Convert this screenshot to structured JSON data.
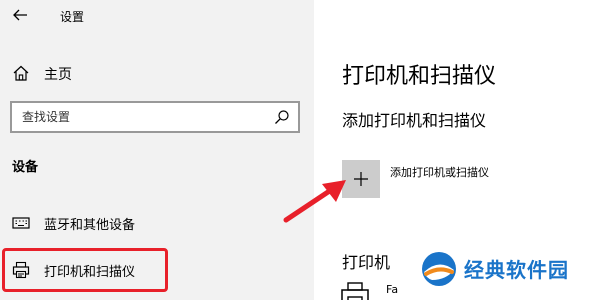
{
  "window": {
    "title": "设置"
  },
  "sidebar": {
    "home_label": "主页",
    "search": {
      "placeholder": "查找设置"
    },
    "section_title": "设备",
    "items": [
      {
        "label": "蓝牙和其他设备",
        "icon": "keyboard-icon"
      },
      {
        "label": "打印机和扫描仪",
        "icon": "printer-icon",
        "highlighted": true
      }
    ]
  },
  "main": {
    "title": "打印机和扫描仪",
    "subtitle": "添加打印机和扫描仪",
    "add_button_label": "添加打印机或扫描仪",
    "printers_heading": "打印机",
    "printer_list": [
      {
        "name": "Fa"
      }
    ]
  },
  "watermark": {
    "text": "经典软件园"
  },
  "colors": {
    "sidebar_bg": "#f2f2f2",
    "add_button_bg": "#cccccc",
    "highlight_border": "#e8202a",
    "arrow": "#e8202a",
    "watermark_text": "#1a74c9"
  }
}
